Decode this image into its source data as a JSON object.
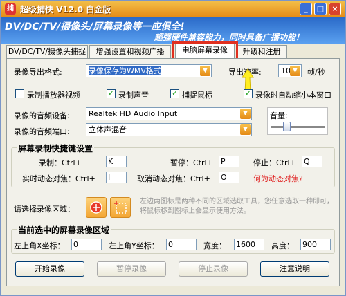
{
  "window": {
    "title": "超级捕快 V12.0 白金版"
  },
  "banner": {
    "line1": "DV/DC/TV/摄像头/屏幕录像等一应俱全!",
    "line2": "超强硬件兼容能力，同时具备广播功能！"
  },
  "tabs": [
    {
      "label": "DV/DC/TV/摄像头捕捉"
    },
    {
      "label": "增强设置和视频广播"
    },
    {
      "label": "电脑屏幕录像"
    },
    {
      "label": "升级和注册"
    }
  ],
  "export": {
    "label": "录像导出格式:",
    "value": "录像保存为WMV格式",
    "rate_label": "导出速率:",
    "rate_value": "10",
    "rate_unit": "帧/秒"
  },
  "options": [
    {
      "label": "录制播放器视频",
      "checked": false
    },
    {
      "label": "录制声音",
      "checked": true
    },
    {
      "label": "捕捉鼠标",
      "checked": true
    },
    {
      "label": "录像时自动缩小本窗口",
      "checked": true
    }
  ],
  "audio": {
    "device_label": "录像的音频设备:",
    "device_value": "Realtek HD Audio Input",
    "port_label": "录像的音频端口:",
    "port_value": "立体声混音",
    "volume_label": "音量:",
    "volume_level": 0.25
  },
  "hotkeys": {
    "title": "屏幕录制快捷键设置",
    "record_label": "录制：Ctrl+",
    "record_key": "K",
    "pause_label": "暂停：Ctrl+",
    "pause_key": "P",
    "stop_label": "停止：Ctrl+",
    "stop_key": "Q",
    "focus_label": "实时动态对焦：Ctrl+",
    "focus_key": "I",
    "cancel_label": "取消动态对焦：Ctrl+",
    "cancel_key": "O",
    "help_link": "何为动态对焦?"
  },
  "region": {
    "label": "请选择录像区域：",
    "hint": "左边两图标是两种不同的区域选取工具，您任意选取一种即可，将鼠标移到图标上会显示使用方法。"
  },
  "current": {
    "title": "当前选中的屏幕录像区域",
    "x_label": "左上角X坐标：",
    "x_value": "0",
    "y_label": "左上角Y坐标：",
    "y_value": "0",
    "w_label": "宽度：",
    "w_value": "1600",
    "h_label": "高度：",
    "h_value": "900"
  },
  "buttons": {
    "start": "开始录像",
    "pause": "暂停录像",
    "stop": "停止录像",
    "about": "注意说明"
  },
  "colors": {
    "title_bar": "#e48a16",
    "banner": "#2a6ac8",
    "highlight": "#e03020",
    "check": "#21a121"
  }
}
